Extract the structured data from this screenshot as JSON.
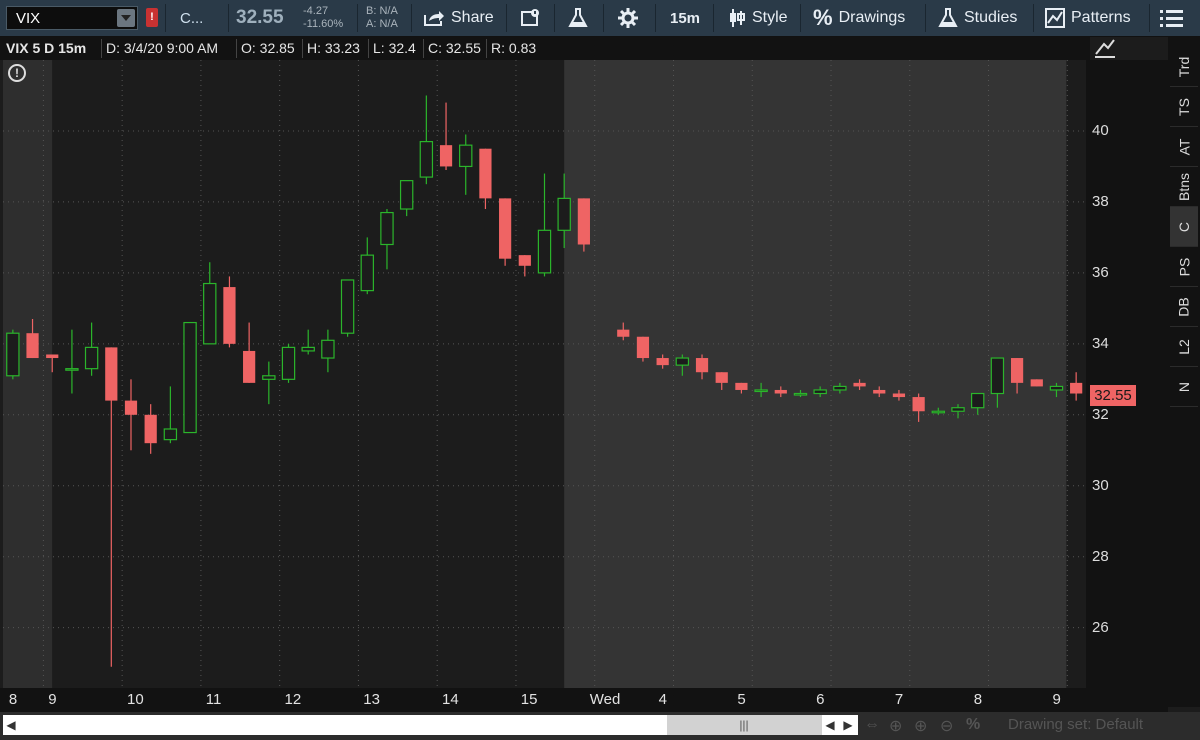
{
  "toolbar": {
    "symbol": "VIX",
    "alert_flag": "!",
    "company": "C...",
    "last_price": "32.55",
    "change": "-4.27",
    "change_pct": "-11.60%",
    "bid": "B: N/A",
    "ask": "A: N/A",
    "share_label": "Share",
    "timeframe_label": "15m",
    "style_label": "Style",
    "drawings_label": "Drawings",
    "studies_label": "Studies",
    "patterns_label": "Patterns"
  },
  "info_bar": {
    "title": "VIX 5 D 15m",
    "date": "D: 3/4/20 9:00 AM",
    "open": "O: 32.85",
    "high": "H: 33.23",
    "low": "L: 32.4",
    "close": "C: 32.55",
    "range": "R: 0.83"
  },
  "price_axis": {
    "ticks": [
      "40",
      "38",
      "36",
      "34",
      "32",
      "30",
      "28",
      "26"
    ],
    "last_tag": "32.55"
  },
  "time_axis": {
    "labels": [
      "8",
      "9",
      "10",
      "11",
      "12",
      "13",
      "14",
      "15",
      "Wed",
      "4",
      "5",
      "6",
      "7",
      "8",
      "9"
    ]
  },
  "side_tabs": [
    "Trd",
    "TS",
    "AT",
    "Btns",
    "C",
    "PS",
    "DB",
    "L2",
    "N"
  ],
  "bottom_bar": {
    "drawing_set": "Drawing set: Default"
  },
  "colors": {
    "up": "#2bb52b",
    "down": "#ef6464",
    "plot_bg_ext": "#2e2e2e",
    "plot_bg_regular": "#1c1c1c",
    "plot_bg_next": "#343434"
  },
  "chart_data": {
    "type": "candlestick",
    "title": "VIX 5 D 15m",
    "ylim": [
      24.3,
      42
    ],
    "y_ticks": [
      26,
      28,
      30,
      32,
      34,
      36,
      38,
      40
    ],
    "session_regions": [
      {
        "type": "extended",
        "from": 0,
        "to": 2.5
      },
      {
        "type": "regular",
        "from": 2.5,
        "to": 28.5
      },
      {
        "type": "extended",
        "from": 28.5,
        "to": 54
      }
    ],
    "candles": [
      {
        "o": 33.1,
        "h": 34.4,
        "l": 33.0,
        "c": 34.3
      },
      {
        "o": 34.3,
        "h": 34.7,
        "l": 33.6,
        "c": 33.6
      },
      {
        "o": 33.7,
        "h": 33.7,
        "l": 33.2,
        "c": 33.6
      },
      {
        "o": 33.3,
        "h": 34.4,
        "l": 32.6,
        "c": 33.3
      },
      {
        "o": 33.3,
        "h": 34.6,
        "l": 33.1,
        "c": 33.9
      },
      {
        "o": 33.9,
        "h": 33.9,
        "l": 24.9,
        "c": 32.4
      },
      {
        "o": 32.4,
        "h": 33.0,
        "l": 31.0,
        "c": 32.0
      },
      {
        "o": 32.0,
        "h": 32.3,
        "l": 30.9,
        "c": 31.2
      },
      {
        "o": 31.3,
        "h": 32.8,
        "l": 31.2,
        "c": 31.6
      },
      {
        "o": 31.5,
        "h": 34.6,
        "l": 31.5,
        "c": 34.6
      },
      {
        "o": 34.0,
        "h": 36.3,
        "l": 34.0,
        "c": 35.7
      },
      {
        "o": 35.6,
        "h": 35.9,
        "l": 33.9,
        "c": 34.0
      },
      {
        "o": 33.8,
        "h": 34.6,
        "l": 32.9,
        "c": 32.9
      },
      {
        "o": 33.0,
        "h": 33.5,
        "l": 32.3,
        "c": 33.1
      },
      {
        "o": 33.0,
        "h": 34.0,
        "l": 32.9,
        "c": 33.9
      },
      {
        "o": 33.8,
        "h": 34.4,
        "l": 33.7,
        "c": 33.9
      },
      {
        "o": 33.6,
        "h": 34.4,
        "l": 33.2,
        "c": 34.1
      },
      {
        "o": 34.3,
        "h": 35.8,
        "l": 34.2,
        "c": 35.8
      },
      {
        "o": 35.5,
        "h": 37.0,
        "l": 35.4,
        "c": 36.5
      },
      {
        "o": 36.8,
        "h": 37.8,
        "l": 36.1,
        "c": 37.7
      },
      {
        "o": 37.8,
        "h": 38.6,
        "l": 37.6,
        "c": 38.6
      },
      {
        "o": 38.7,
        "h": 41.0,
        "l": 38.5,
        "c": 39.7
      },
      {
        "o": 39.6,
        "h": 40.8,
        "l": 38.9,
        "c": 39.0
      },
      {
        "o": 39.0,
        "h": 39.9,
        "l": 38.2,
        "c": 39.6
      },
      {
        "o": 39.5,
        "h": 39.5,
        "l": 37.8,
        "c": 38.1
      },
      {
        "o": 38.1,
        "h": 38.1,
        "l": 36.2,
        "c": 36.4
      },
      {
        "o": 36.5,
        "h": 36.5,
        "l": 35.9,
        "c": 36.2
      },
      {
        "o": 36.0,
        "h": 38.8,
        "l": 35.9,
        "c": 37.2
      },
      {
        "o": 37.2,
        "h": 38.8,
        "l": 36.7,
        "c": 38.1
      },
      {
        "o": 38.1,
        "h": 38.1,
        "l": 36.6,
        "c": 36.8
      },
      null,
      {
        "o": 34.4,
        "h": 34.6,
        "l": 34.1,
        "c": 34.2
      },
      {
        "o": 34.2,
        "h": 34.2,
        "l": 33.5,
        "c": 33.6
      },
      {
        "o": 33.6,
        "h": 33.7,
        "l": 33.3,
        "c": 33.4
      },
      {
        "o": 33.4,
        "h": 33.7,
        "l": 33.1,
        "c": 33.6
      },
      {
        "o": 33.6,
        "h": 33.7,
        "l": 33.0,
        "c": 33.2
      },
      {
        "o": 33.2,
        "h": 33.2,
        "l": 32.7,
        "c": 32.9
      },
      {
        "o": 32.9,
        "h": 32.9,
        "l": 32.6,
        "c": 32.7
      },
      {
        "o": 32.7,
        "h": 32.9,
        "l": 32.5,
        "c": 32.7
      },
      {
        "o": 32.7,
        "h": 32.8,
        "l": 32.5,
        "c": 32.6
      },
      {
        "o": 32.6,
        "h": 32.7,
        "l": 32.5,
        "c": 32.6
      },
      {
        "o": 32.6,
        "h": 32.8,
        "l": 32.5,
        "c": 32.7
      },
      {
        "o": 32.7,
        "h": 32.9,
        "l": 32.6,
        "c": 32.8
      },
      {
        "o": 32.9,
        "h": 33.0,
        "l": 32.7,
        "c": 32.8
      },
      {
        "o": 32.7,
        "h": 32.8,
        "l": 32.5,
        "c": 32.6
      },
      {
        "o": 32.6,
        "h": 32.7,
        "l": 32.4,
        "c": 32.5
      },
      {
        "o": 32.5,
        "h": 32.6,
        "l": 31.8,
        "c": 32.1
      },
      {
        "o": 32.1,
        "h": 32.2,
        "l": 32.0,
        "c": 32.1
      },
      {
        "o": 32.1,
        "h": 32.3,
        "l": 31.9,
        "c": 32.2
      },
      {
        "o": 32.2,
        "h": 32.6,
        "l": 32.0,
        "c": 32.6
      },
      {
        "o": 32.6,
        "h": 33.6,
        "l": 32.2,
        "c": 33.6
      },
      {
        "o": 33.6,
        "h": 33.6,
        "l": 32.6,
        "c": 32.9
      },
      {
        "o": 33.0,
        "h": 33.0,
        "l": 32.8,
        "c": 32.8
      },
      {
        "o": 32.7,
        "h": 32.9,
        "l": 32.5,
        "c": 32.8
      },
      {
        "o": 32.9,
        "h": 33.2,
        "l": 32.4,
        "c": 32.6
      }
    ]
  }
}
